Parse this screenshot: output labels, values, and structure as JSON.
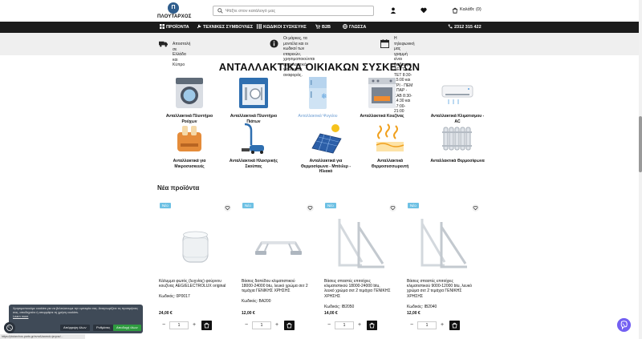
{
  "header": {
    "logo_mark": "Π",
    "logo_name": "ΠΛΟΥΤΑΡΧΟΣ",
    "search_placeholder": "Ψάξτε στον κατάλογό μας",
    "cart_label": "Καλάθι: (0)"
  },
  "nav": {
    "items": [
      {
        "label": "ΠΡΟΪΟΝΤΑ",
        "icon": "grid-icon"
      },
      {
        "label": "ΤΕΧΝΙΚΕΣ ΣΥΜΒΟΥΛΕΣ",
        "icon": "wrench-icon"
      },
      {
        "label": "ΚΩΔΙΚΟΙ ΣΥΣΚΕΥΗΣ",
        "icon": "barcode-icon"
      },
      {
        "label": "B2B",
        "icon": "cart-icon"
      },
      {
        "label": "ΓΛΩΣΣΑ",
        "icon": "globe-icon"
      }
    ],
    "phone": "2312 315 422"
  },
  "info": {
    "shipping": "Αποστολή σε Ελλάδα και Κύπρο",
    "notice_line1": "Οι μάρκες, τα μοντέλα και οι κωδικοί των",
    "notice_line2": "εταιρειών, χρησιμοποιούνται αποκλειστικά",
    "notice_line3": "για λόγους αναφοράς.",
    "hours_line1": "Η τηλεφωνική μας γραμμή είναι διαθέσιμη",
    "hours_line2": "ΔΕΥΤ - ΤΕΤ 8:30-15:00 και ΤΡΙ - ΠΕΜ - ΠΑΡ -",
    "hours_line3": "ΣΑΒ 8:30-14:30 και 17:00-21:00"
  },
  "section_title": "ΑΝΤΑΛΛΑΚΤΙΚΑ ΟΙΚΙΑΚΩΝ ΣΥΣΚΕΥΩΝ",
  "categories": [
    {
      "line1": "Ανταλλακτικά Πλυντήριο",
      "line2": "Ρούχων",
      "line3": ""
    },
    {
      "line1": "Ανταλλακτικά Πλυντήριο",
      "line2": "Πιάτων",
      "line3": ""
    },
    {
      "line1": "Ανταλλακτικά Ψυγείου",
      "line2": "",
      "line3": ""
    },
    {
      "line1": "Ανταλλακτικά Κουζίνας",
      "line2": "",
      "line3": ""
    },
    {
      "line1": "Ανταλλακτικά Κλιματισμου -",
      "line2": "AC",
      "line3": ""
    },
    {
      "line1": "Ανταλλακτικά για",
      "line2": "Μικροσυσκευές",
      "line3": ""
    },
    {
      "line1": "Ανταλλακτικά Ηλεκτρικής",
      "line2": "Σκούπας",
      "line3": ""
    },
    {
      "line1": "Ανταλλακτικά για",
      "line2": "Θερμοσίφωνα - Μπόιλερ -",
      "line3": "Ηλιακό"
    },
    {
      "line1": "Ανταλλακτικά",
      "line2": "Θερμοσυσσωρευτή",
      "line3": ""
    },
    {
      "line1": "Ανταλλακτικά Θερμοσίφωνα",
      "line2": "",
      "line3": ""
    }
  ],
  "new_products_title": "Νέα προϊόντα",
  "products": [
    {
      "badge": "Νέο",
      "title_l1": "Κάλυμμα φωτός (λυχνίας) φούρνου",
      "title_l2": "κουζίνας AEG/ELECTROLUX original",
      "title_l3": "",
      "code": "Κωδικός: 0P0017",
      "price": "24,00 €",
      "qty": "1"
    },
    {
      "badge": "Νέο",
      "title_l1": "Βάσεις δαπέδου κλιματιστικού",
      "title_l2": "18000-24000 btu, λευκό χρώμα σετ 2",
      "title_l3": "τεμάχια ΓΕΝΙΚΗΣ ΧΡΗΣΗΣ",
      "code": "Κωδικός: BA200",
      "price": "12,00 €",
      "qty": "1"
    },
    {
      "badge": "Νέο",
      "title_l1": "Βάσεις σπαστές επιτοίχιες",
      "title_l2": "κλιματιστικού 18000-24000 btu,",
      "title_l3": "λευκό χρώμα σετ 2 τεμάχια ΓΕΝΙΚΗΣ",
      "title_l4": "ΧΡΗΣΗΣ",
      "code": "Κωδικός: IB2050",
      "price": "14,00 €",
      "qty": "1"
    },
    {
      "badge": "Νέο",
      "title_l1": "Βάσεις σπαστές επιτοίχιες",
      "title_l2": "κλιματιστικού 9000-12000 btu, λευκό",
      "title_l3": "χρώμα σετ 2 τεμάχια ΓΕΝΙΚΗΣ",
      "title_l4": "ΧΡΗΣΗΣ",
      "code": "Κωδικός: IB2040",
      "price": "12,00 €",
      "qty": "1"
    }
  ],
  "cookie": {
    "text": "Χρησιμοποιούμε cookies για να βελτιώσουμε την εμπειρία σας. Αναγνωρίζετε τις προτιμήσεις σας, αποδεχτείτε ή απορρίψτε τη χρήση cookies.",
    "learn_more": "Learn more",
    "reject": "Απόρριψη όλων",
    "settings": "Ρυθμίσεις",
    "accept": "Αποδοχή όλων"
  },
  "status_url": "https://plutarchos-parts.gr/ανταλλακτικά-ψυγεια/...",
  "colors": {
    "nav_bg": "#1c1c1c",
    "badge": "#6ec1e4",
    "accept": "#2e9b3f",
    "viber": "#7360f2"
  }
}
